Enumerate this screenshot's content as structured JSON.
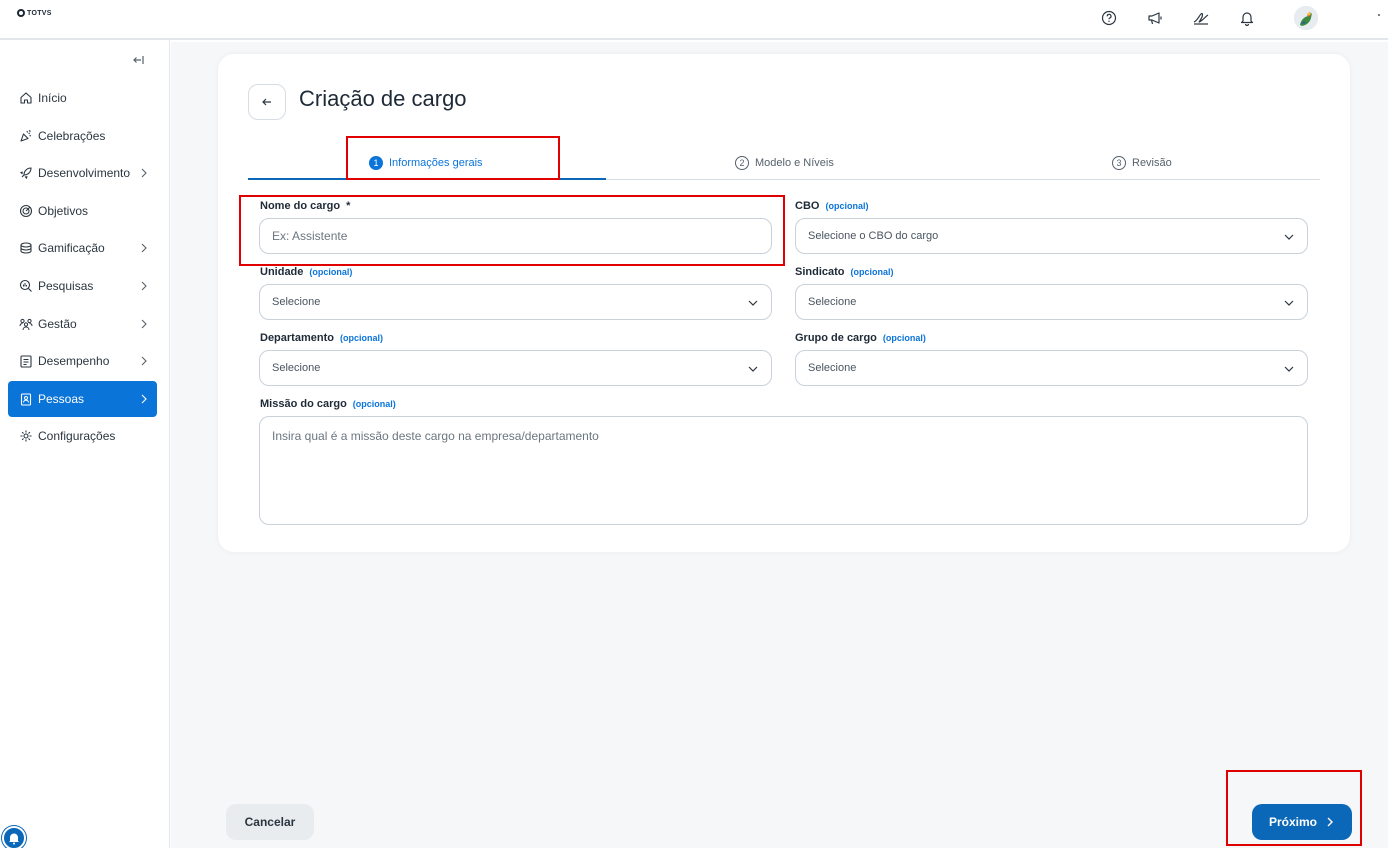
{
  "brand": {
    "logo_text": "TOTVS"
  },
  "sidebar": {
    "items": [
      {
        "label": "Início",
        "icon": "home-icon",
        "has_children": false,
        "active": false
      },
      {
        "label": "Celebrações",
        "icon": "party-icon",
        "has_children": false,
        "active": false
      },
      {
        "label": "Desenvolvimento",
        "icon": "rocket-icon",
        "has_children": true,
        "active": false
      },
      {
        "label": "Objetivos",
        "icon": "target-icon",
        "has_children": false,
        "active": false
      },
      {
        "label": "Gamificação",
        "icon": "coins-icon",
        "has_children": true,
        "active": false
      },
      {
        "label": "Pesquisas",
        "icon": "survey-icon",
        "has_children": true,
        "active": false
      },
      {
        "label": "Gestão",
        "icon": "people-icon",
        "has_children": true,
        "active": false
      },
      {
        "label": "Desempenho",
        "icon": "clipboard-icon",
        "has_children": true,
        "active": false
      },
      {
        "label": "Pessoas",
        "icon": "badge-icon",
        "has_children": true,
        "active": true
      },
      {
        "label": "Configurações",
        "icon": "gear-icon",
        "has_children": false,
        "active": false
      }
    ]
  },
  "page": {
    "title": "Criação de cargo"
  },
  "steps": [
    {
      "number": "1",
      "label": "Informações gerais",
      "active": true
    },
    {
      "number": "2",
      "label": "Modelo e Níveis",
      "active": false
    },
    {
      "number": "3",
      "label": "Revisão",
      "active": false
    }
  ],
  "form": {
    "optional_tag": "(opcional)",
    "nome": {
      "label": "Nome do cargo",
      "required_mark": "*",
      "placeholder": "Ex: Assistente"
    },
    "cbo": {
      "label": "CBO",
      "value": "Selecione o CBO do cargo"
    },
    "unidade": {
      "label": "Unidade",
      "value": "Selecione"
    },
    "sindicato": {
      "label": "Sindicato",
      "value": "Selecione"
    },
    "departamento": {
      "label": "Departamento",
      "value": "Selecione"
    },
    "grupo": {
      "label": "Grupo de cargo",
      "value": "Selecione"
    },
    "missao": {
      "label": "Missão do cargo",
      "placeholder": "Insira qual é a missão deste cargo na empresa/departamento"
    }
  },
  "footer": {
    "cancel_label": "Cancelar",
    "next_label": "Próximo"
  },
  "colors": {
    "primary": "#0b74d9",
    "primary_dark": "#0b67b7",
    "highlight": "#e00000"
  }
}
